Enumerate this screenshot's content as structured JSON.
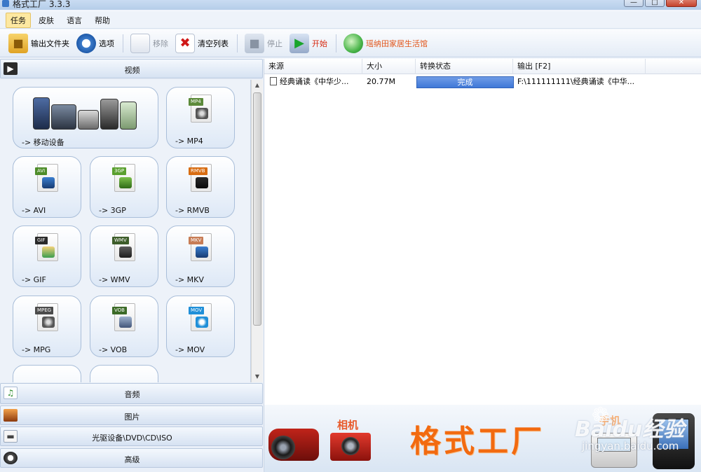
{
  "window": {
    "title": "格式工厂 3.3.3",
    "controls": [
      "minimize",
      "maximize",
      "close"
    ]
  },
  "menu": {
    "items": [
      {
        "label": "任务",
        "active": true
      },
      {
        "label": "皮肤",
        "active": false
      },
      {
        "label": "语言",
        "active": false
      },
      {
        "label": "帮助",
        "active": false
      }
    ]
  },
  "toolbar": {
    "output_folder": "输出文件夹",
    "options": "选项",
    "remove": "移除",
    "clear_list": "清空列表",
    "stop": "停止",
    "start": "开始",
    "link": "瑶纳田家居生活馆"
  },
  "categories": {
    "video": "视频",
    "audio": "音频",
    "picture": "图片",
    "rom": "光驱设备\\DVD\\CD\\ISO",
    "advanced": "高级"
  },
  "video_tiles": [
    {
      "label": "-> 移动设备",
      "tag": "",
      "color": ""
    },
    {
      "label": "-> MP4",
      "tag": "MP4",
      "color": "#5c8a3a"
    },
    {
      "label": "-> AVI",
      "tag": "AVI",
      "color": "#4e8d2a"
    },
    {
      "label": "-> 3GP",
      "tag": "3GP",
      "color": "#5aa02f"
    },
    {
      "label": "-> RMVB",
      "tag": "RMVB",
      "color": "#d86d12"
    },
    {
      "label": "-> GIF",
      "tag": "GIF",
      "color": "#2a2a2a"
    },
    {
      "label": "-> WMV",
      "tag": "WMV",
      "color": "#3d5d2a"
    },
    {
      "label": "-> MKV",
      "tag": "MKV",
      "color": "#c77c55"
    },
    {
      "label": "-> MPG",
      "tag": "MPEG",
      "color": "#4b4b4b"
    },
    {
      "label": "-> VOB",
      "tag": "VOB",
      "color": "#3c6b28"
    },
    {
      "label": "-> MOV",
      "tag": "MOV",
      "color": "#1f8fd8"
    }
  ],
  "file_list": {
    "columns": [
      "来源",
      "大小",
      "转换状态",
      "输出 [F2]"
    ],
    "rows": [
      {
        "source": "经典诵读《中华少...",
        "size": "20.77M",
        "status": "完成",
        "output": "F:\\111111111\\经典诵读《中华..."
      }
    ]
  },
  "banner": {
    "camera_label": "相机",
    "logo": "格式工厂",
    "phone_label": "手机"
  },
  "watermark": {
    "brand": "Baidu经验",
    "url": "jingyan.baidu.com"
  },
  "colors": {
    "status_complete": "#3f78d8",
    "start_label": "#d6280f",
    "logo": "#f26a10"
  }
}
